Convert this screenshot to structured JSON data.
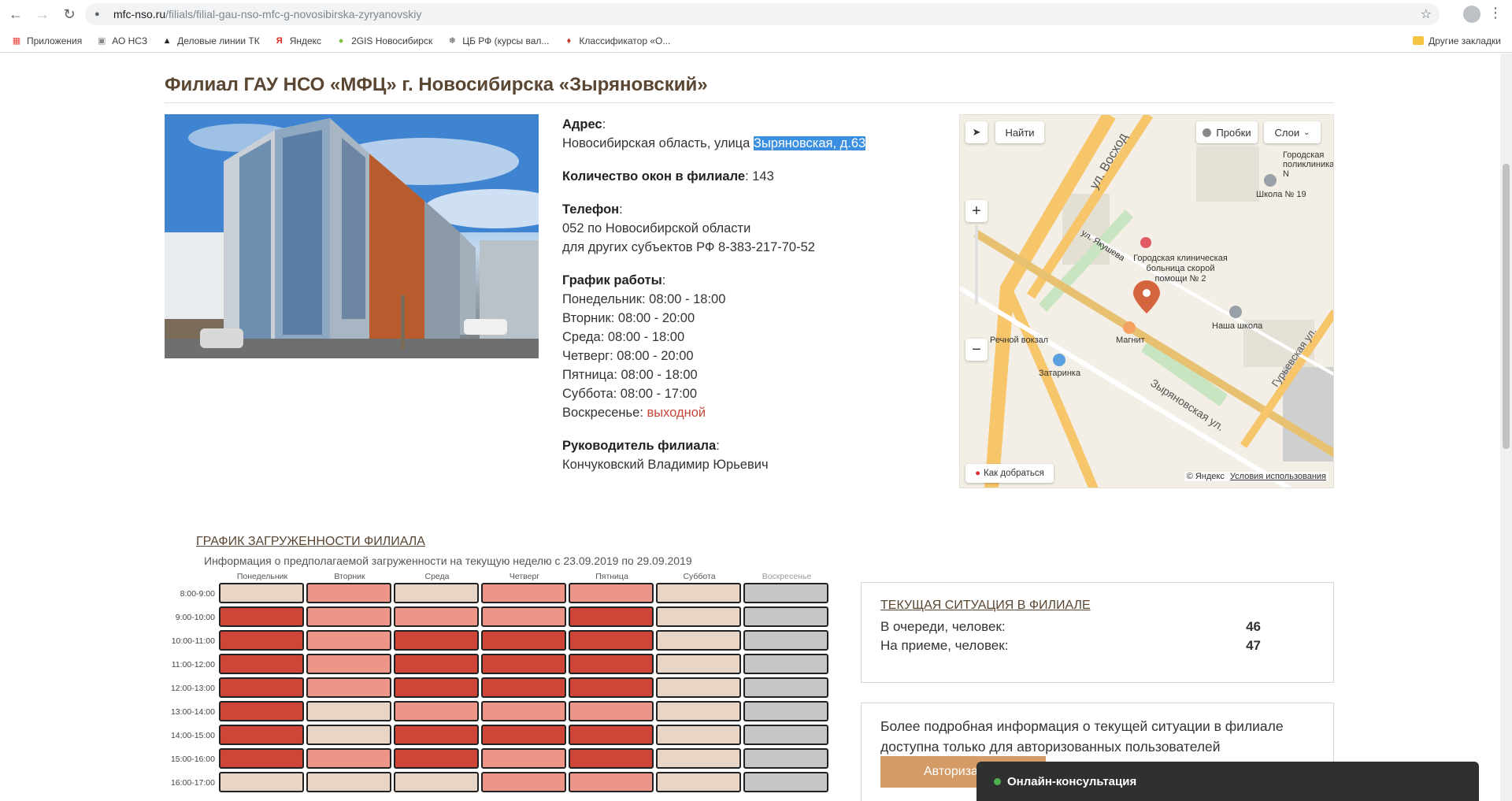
{
  "browser": {
    "url_host": "mfc-nso.ru",
    "url_path": "/filials/filial-gau-nso-mfc-g-novosibirska-zyryanovskiy",
    "bookmarks": [
      "Приложения",
      "АО НСЗ",
      "Деловые линии ТК",
      "Яндекс",
      "2GIS Новосибирск",
      "ЦБ РФ (курсы вал...",
      "Классификатор «О..."
    ],
    "other_bookmarks": "Другие закладки"
  },
  "branch": {
    "title": "Филиал ГАУ НСО «МФЦ» г. Новосибирска «Зыряновский»",
    "address_label": "Адрес",
    "address_prefix": "Новосибирская область, улица ",
    "address_selected": "Зыряновская, д.63",
    "windows_label": "Количество окон в филиале",
    "windows_value": ": 143",
    "phone_label": "Телефон",
    "phone_line1": "052 по Новосибирской области",
    "phone_line2": "для других субъектов РФ 8-383-217-70-52",
    "schedule_label": "График работы",
    "schedule": [
      "Понедельник: 08:00 - 18:00",
      "Вторник: 08:00 - 20:00",
      "Среда: 08:00 - 18:00",
      "Четверг: 08:00 - 20:00",
      "Пятница: 08:00 - 18:00",
      "Суббота: 08:00 - 17:00"
    ],
    "sunday_prefix": "Воскресенье: ",
    "sunday_value": "выходной",
    "head_label": "Руководитель филиала",
    "head_name": "Кончуковский Владимир Юрьевич"
  },
  "map": {
    "find_btn": "Найти",
    "traffic_btn": "Пробки",
    "layers_btn": "Слои",
    "route_btn": "Как добраться",
    "copyright": "© Яндекс",
    "terms": "Условия использования",
    "labels": {
      "hospital": "Городская клиническая больница скорой помощи № 2",
      "station": "Речной вокзал",
      "magnit": "Магнит",
      "zatarinka": "Затаринка",
      "school": "Наша школа",
      "school19": "Школа № 19",
      "polyclinic": "Городская поликлиника N",
      "street1": "ул. Восход",
      "street2": "Зыряновская ул.",
      "street3": "Гурьевская ул.",
      "street4": "ул. Якушева"
    }
  },
  "load": {
    "title": "ГРАФИК ЗАГРУЖЕННОСТИ ФИЛИАЛА",
    "subtitle": "Информация о предполагаемой загруженности на текущую неделю с 23.09.2019 по 29.09.2019",
    "days": [
      "Понедельник",
      "Вторник",
      "Среда",
      "Четверг",
      "Пятница",
      "Суббота",
      "Воскресенье"
    ],
    "times": [
      "8:00-9:00",
      "9:00-10:00",
      "10:00-11:00",
      "11:00-12:00",
      "12:00-13:00",
      "13:00-14:00",
      "14:00-15:00",
      "15:00-16:00",
      "16:00-17:00"
    ],
    "levels": [
      [
        0,
        1,
        0,
        1,
        1,
        0,
        3
      ],
      [
        2,
        1,
        1,
        1,
        2,
        0,
        3
      ],
      [
        2,
        1,
        2,
        2,
        2,
        0,
        3
      ],
      [
        2,
        1,
        2,
        2,
        2,
        0,
        3
      ],
      [
        2,
        1,
        2,
        2,
        2,
        0,
        3
      ],
      [
        2,
        0,
        1,
        1,
        1,
        0,
        3
      ],
      [
        2,
        0,
        2,
        2,
        2,
        0,
        3
      ],
      [
        2,
        1,
        2,
        1,
        2,
        0,
        3
      ],
      [
        0,
        0,
        0,
        1,
        1,
        0,
        3
      ]
    ],
    "level_colors": [
      "#e8d5c5",
      "#ec9588",
      "#cd4637",
      "#c6c6c6"
    ]
  },
  "situation": {
    "title": "ТЕКУЩАЯ СИТУАЦИЯ В ФИЛИАЛЕ",
    "queue_label": "В очереди, человек:",
    "queue_value": "46",
    "reception_label": "На приеме, человек:",
    "reception_value": "47"
  },
  "auth": {
    "text": "Более подробная информация о текущей ситуации в филиале доступна только для авторизованных пользователей",
    "button": "Авториза"
  },
  "chat": {
    "label": "Онлайн-консультация"
  }
}
